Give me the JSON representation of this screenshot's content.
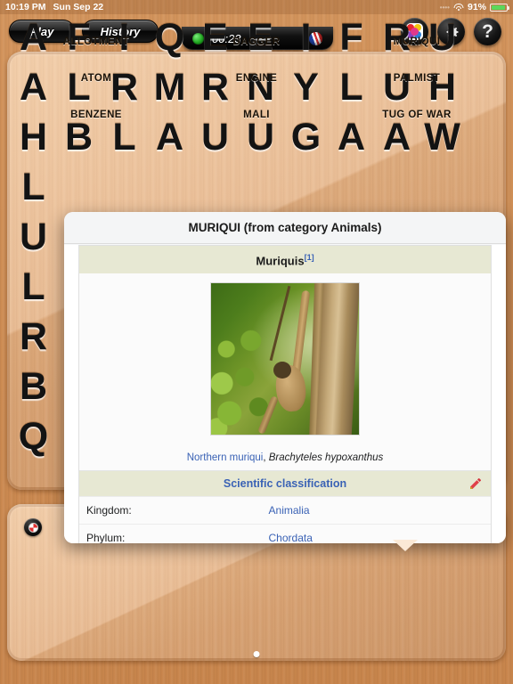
{
  "statusbar": {
    "time": "10:19 PM",
    "date": "Sun Sep 22",
    "battery_percent": "91%",
    "wifi_icon": "wifi-icon",
    "battery_icon": "battery-icon",
    "signal_dots": "••••"
  },
  "toolbar": {
    "play_label": "Play",
    "history_label": "History",
    "timer": "00:23",
    "timer_ball_icon": "green-ball-icon",
    "flag_icon": "flag-ball-icon",
    "palette_icon": "palette-icon",
    "gear_icon": "gear-icon",
    "help_icon": "question-mark-icon"
  },
  "grid": {
    "rows": [
      [
        "A",
        "F",
        "I",
        "Q",
        "E",
        "E",
        "I",
        "F",
        "R",
        "U"
      ],
      [
        "A",
        "L",
        "R",
        "M",
        "R",
        "N",
        "Y",
        "L",
        "U",
        "H"
      ],
      [
        "H",
        "B",
        "L",
        "A",
        "U",
        "U",
        "G",
        "A",
        "A",
        "W"
      ],
      [
        "L",
        "",
        "",
        "",
        "",
        "",
        "",
        "",
        "",
        ""
      ],
      [
        "U",
        "",
        "",
        "",
        "",
        "",
        "",
        "",
        "",
        ""
      ],
      [
        "L",
        "",
        "",
        "",
        "",
        "",
        "",
        "",
        "",
        ""
      ],
      [
        "R",
        "",
        "",
        "",
        "",
        "",
        "",
        "",
        "",
        ""
      ],
      [
        "B",
        "",
        "",
        "",
        "",
        "",
        "",
        "",
        "",
        ""
      ],
      [
        "Q",
        "",
        "",
        "",
        "",
        "",
        "",
        "",
        "",
        ""
      ]
    ]
  },
  "popup": {
    "title": "MURIQUI (from category Animals)",
    "infobox": {
      "heading": "Muriquis",
      "heading_ref": "[1]",
      "image_alt": "Northern muriqui monkey hanging from a tree",
      "caption_link": "Northern muriqui",
      "caption_rest": ", ",
      "caption_italic": "Brachyteles hypoxanthus",
      "section_title": "Scientific classification",
      "edit_icon": "edit-pencil-icon",
      "rows": [
        {
          "key": "Kingdom:",
          "value": "Animalia"
        },
        {
          "key": "Phylum:",
          "value": "Chordata"
        }
      ]
    }
  },
  "words": {
    "items": [
      "ALLOTMENT",
      "DAGGER",
      "MURIQUI",
      "ATOM",
      "ENGINE",
      "PALMIST",
      "BENZENE",
      "MALI",
      "TUG OF WAR"
    ]
  },
  "bottom": {
    "shuffle_icon": "shuffle-ball-icon",
    "page_dot": "page-indicator-dot"
  },
  "colors": {
    "wood_dark": "#cf8e55",
    "wood_light": "#e8b586",
    "infobox_header": "#e7e8d3",
    "link_blue": "#3a62b5",
    "battery_green": "#5bd75b"
  }
}
